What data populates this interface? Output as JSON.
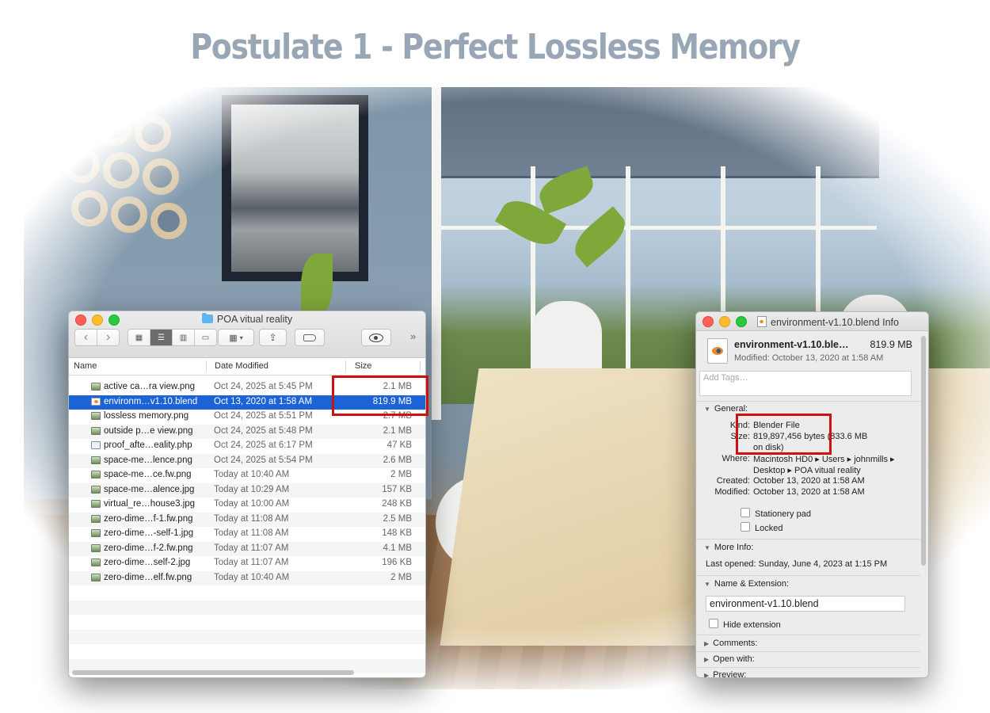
{
  "headline": "Postulate 1 - Perfect Lossless Memory",
  "finder": {
    "title": "POA vitual reality",
    "toolbar": {
      "back": "‹",
      "forward": "›",
      "more": "»"
    },
    "columns": {
      "name": "Name",
      "date": "Date Modified",
      "size": "Size"
    },
    "rows": [
      {
        "name": "active ca…ra view.png",
        "date": "Oct 24, 2025 at 5:45 PM",
        "size": "2.1 MB"
      },
      {
        "name": "environm…v1.10.blend",
        "date": "Oct 13, 2020 at 1:58 AM",
        "size": "819.9 MB"
      },
      {
        "name": "lossless memory.png",
        "date": "Oct 24, 2025 at 5:51 PM",
        "size": "2.7 MB"
      },
      {
        "name": "outside p…e view.png",
        "date": "Oct 24, 2025 at 5:48 PM",
        "size": "2.1 MB"
      },
      {
        "name": "proof_afte…eality.php",
        "date": "Oct 24, 2025 at 6:17 PM",
        "size": "47 KB"
      },
      {
        "name": "space-me…lence.png",
        "date": "Oct 24, 2025 at 5:54 PM",
        "size": "2.6 MB"
      },
      {
        "name": "space-me…ce.fw.png",
        "date": "Today at 10:40 AM",
        "size": "2 MB"
      },
      {
        "name": "space-me…alence.jpg",
        "date": "Today at 10:29 AM",
        "size": "157 KB"
      },
      {
        "name": "virtual_re…house3.jpg",
        "date": "Today at 10:00 AM",
        "size": "248 KB"
      },
      {
        "name": "zero-dime…f-1.fw.png",
        "date": "Today at 11:08 AM",
        "size": "2.5 MB"
      },
      {
        "name": "zero-dime…-self-1.jpg",
        "date": "Today at 11:08 AM",
        "size": "148 KB"
      },
      {
        "name": "zero-dime…f-2.fw.png",
        "date": "Today at 11:07 AM",
        "size": "4.1 MB"
      },
      {
        "name": "zero-dime…self-2.jpg",
        "date": "Today at 11:07 AM",
        "size": "196 KB"
      },
      {
        "name": "zero-dime…elf.fw.png",
        "date": "Today at 10:40 AM",
        "size": "2 MB"
      }
    ]
  },
  "info": {
    "title": "environment-v1.10.blend Info",
    "file_name": "environment-v1.10.ble…",
    "file_size": "819.9 MB",
    "modified_line": "Modified: October 13, 2020 at 1:58 AM",
    "tags_placeholder": "Add Tags…",
    "general": {
      "header": "General:",
      "kind_label": "Kind:",
      "kind": "Blender File",
      "size_label": "Size:",
      "size_line1": "819,897,456 bytes (833.6 MB",
      "size_line2": "on disk)",
      "where_label": "Where:",
      "where_line1": "Macintosh HD0 ▸ Users ▸ johnmills ▸",
      "where_line2": "Desktop ▸ POA vitual reality",
      "created_label": "Created:",
      "created": "October 13, 2020 at 1:58 AM",
      "modified_label": "Modified:",
      "modified": "October 13, 2020 at 1:58 AM",
      "stationery": "Stationery pad",
      "locked": "Locked"
    },
    "more_info": {
      "header": "More Info:",
      "last_opened": "Last opened: Sunday, June 4, 2023 at 1:15 PM"
    },
    "name_ext": {
      "header": "Name & Extension:",
      "value": "environment-v1.10.blend",
      "hide_ext": "Hide extension"
    },
    "comments": "Comments:",
    "open_with": "Open with:",
    "preview": "Preview:"
  },
  "colors": {
    "selection": "#1b63d6",
    "callout": "#cc1111",
    "headline": "#98a6b6"
  }
}
